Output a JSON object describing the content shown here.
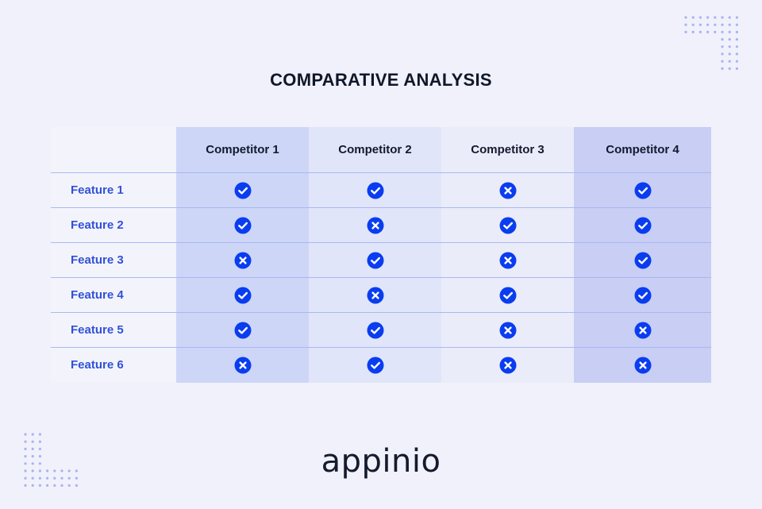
{
  "title": "COMPARATIVE ANALYSIS",
  "colors": {
    "accent": "#0a3df0",
    "feature_label": "#3151d8",
    "title": "#0f172a",
    "background": "#f0f1fa",
    "dots": "#a7b3f2"
  },
  "columns": [
    "Competitor 1",
    "Competitor 2",
    "Competitor 3",
    "Competitor 4"
  ],
  "rows": [
    {
      "feature": "Feature 1",
      "values": [
        "check",
        "check",
        "cross",
        "check"
      ]
    },
    {
      "feature": "Feature 2",
      "values": [
        "check",
        "cross",
        "check",
        "check"
      ]
    },
    {
      "feature": "Feature 3",
      "values": [
        "cross",
        "check",
        "cross",
        "check"
      ]
    },
    {
      "feature": "Feature 4",
      "values": [
        "check",
        "cross",
        "check",
        "check"
      ]
    },
    {
      "feature": "Feature 5",
      "values": [
        "check",
        "check",
        "cross",
        "cross"
      ]
    },
    {
      "feature": "Feature 6",
      "values": [
        "cross",
        "check",
        "cross",
        "cross"
      ]
    }
  ],
  "icons": {
    "check": "check-circle-icon",
    "cross": "x-circle-icon"
  },
  "logo": "appinio"
}
